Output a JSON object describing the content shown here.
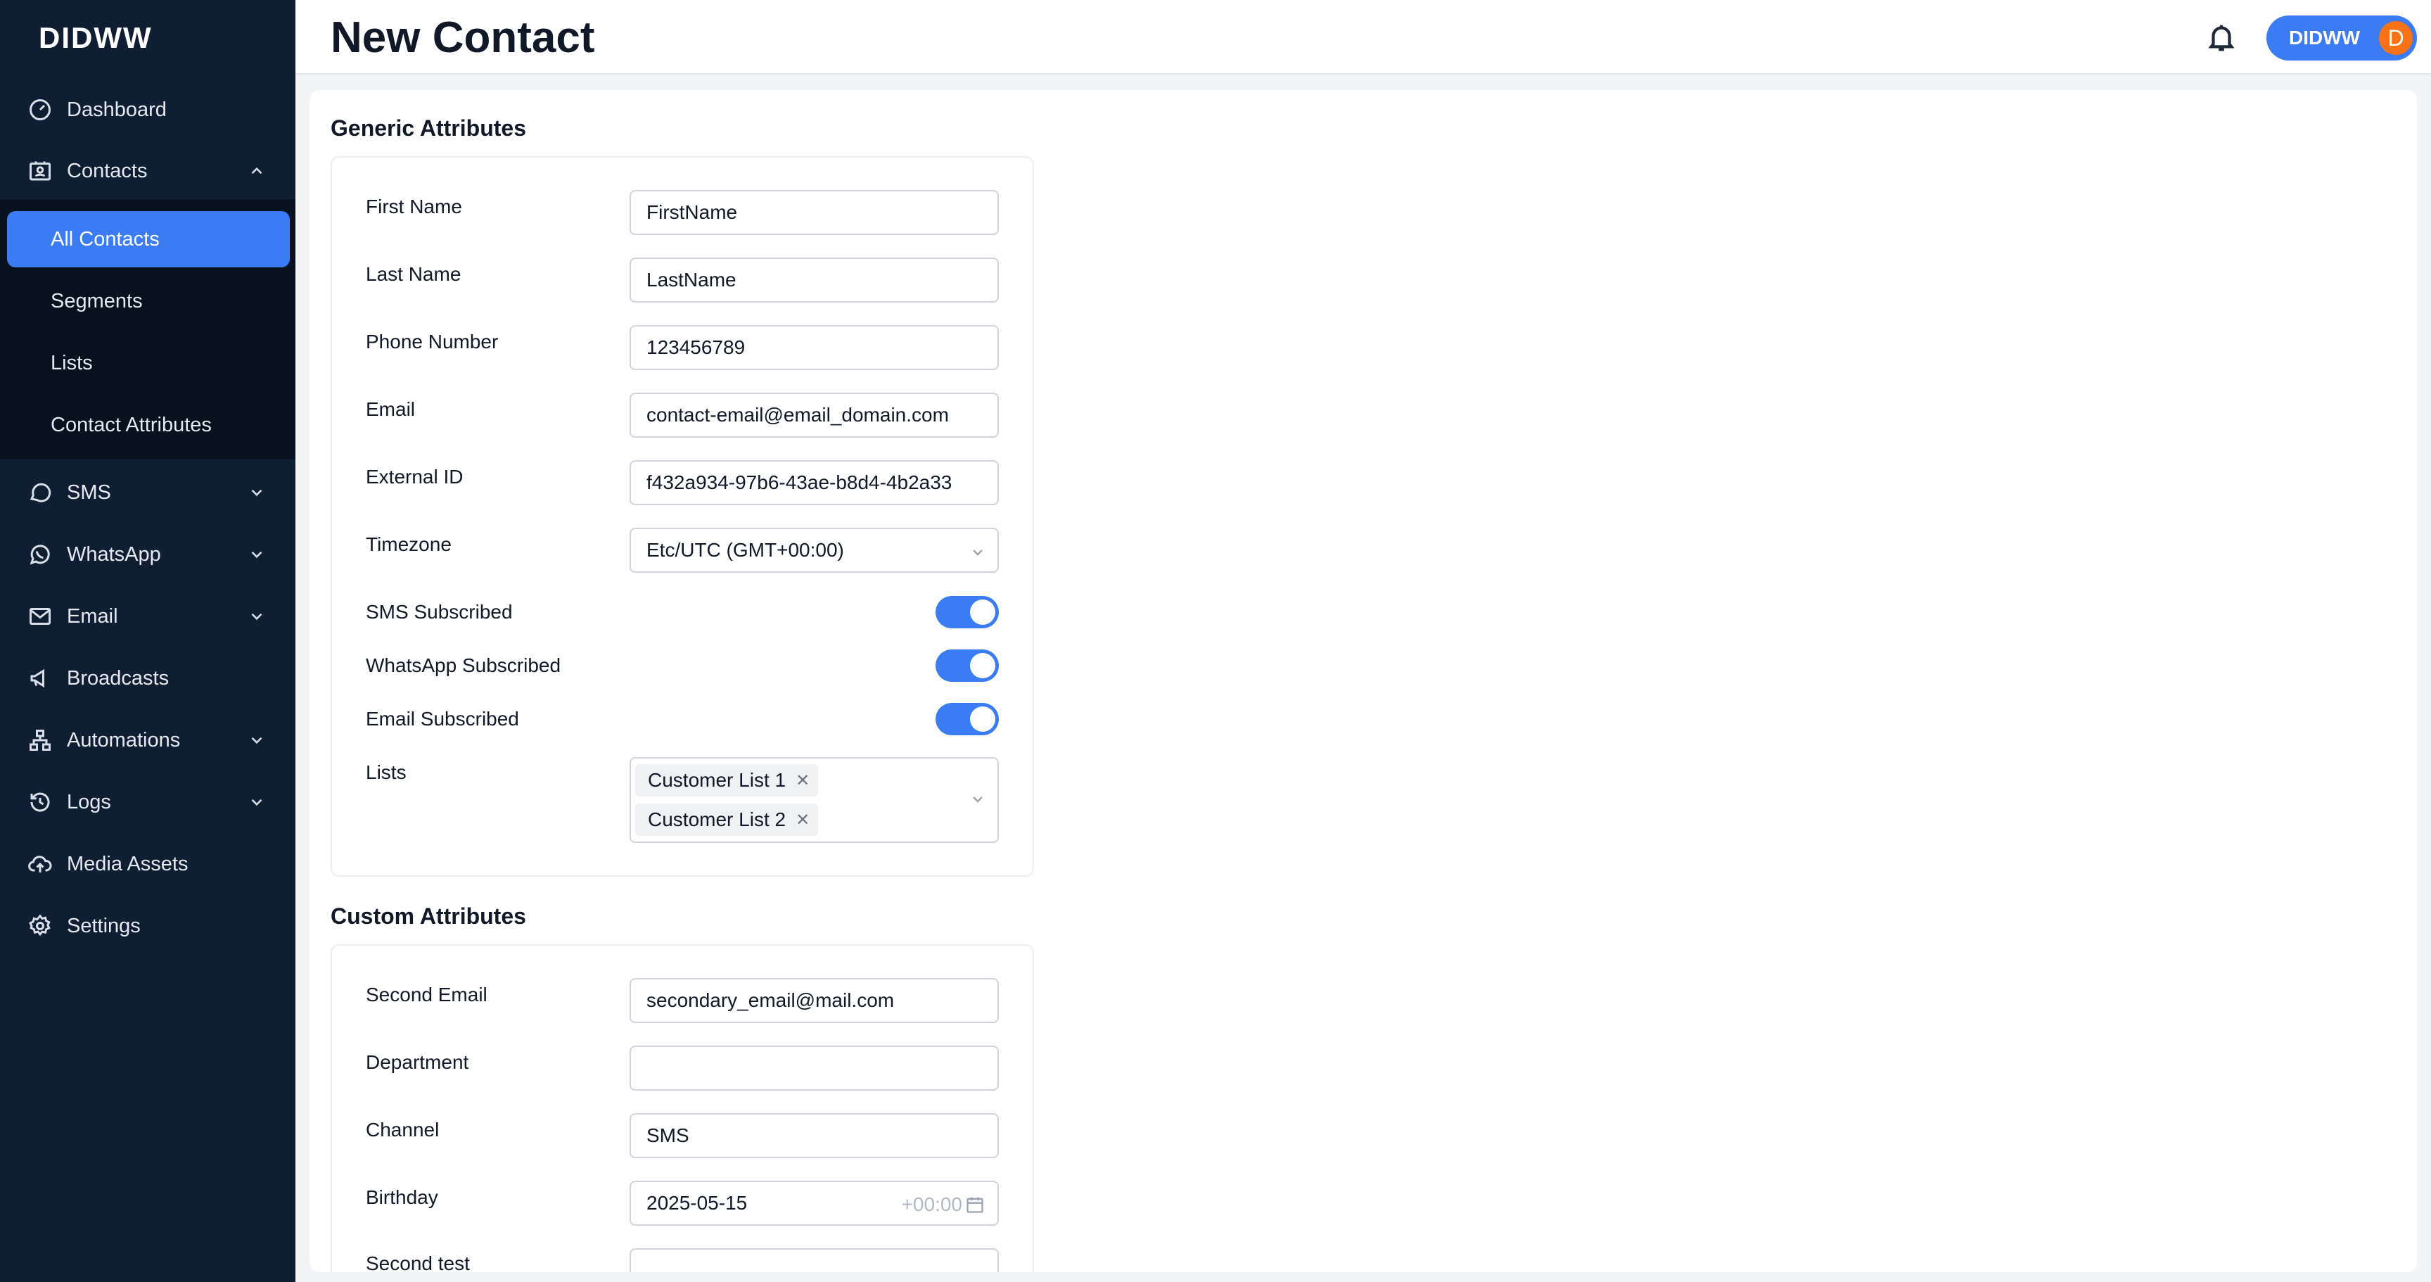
{
  "brand": "DIDWW",
  "header": {
    "title": "New Contact",
    "user_label": "DIDWW",
    "avatar_initial": "D"
  },
  "sidebar": {
    "items": [
      {
        "label": "Dashboard"
      },
      {
        "label": "Contacts"
      },
      {
        "label": "SMS"
      },
      {
        "label": "WhatsApp"
      },
      {
        "label": "Email"
      },
      {
        "label": "Broadcasts"
      },
      {
        "label": "Automations"
      },
      {
        "label": "Logs"
      },
      {
        "label": "Media Assets"
      },
      {
        "label": "Settings"
      }
    ],
    "contacts_sub": [
      {
        "label": "All Contacts"
      },
      {
        "label": "Segments"
      },
      {
        "label": "Lists"
      },
      {
        "label": "Contact Attributes"
      }
    ]
  },
  "generic": {
    "title": "Generic Attributes",
    "first_name": {
      "label": "First Name",
      "value": "FirstName"
    },
    "last_name": {
      "label": "Last Name",
      "value": "LastName"
    },
    "phone": {
      "label": "Phone Number",
      "value": "123456789"
    },
    "email": {
      "label": "Email",
      "value": "contact-email@email_domain.com"
    },
    "external_id": {
      "label": "External ID",
      "value": "f432a934-97b6-43ae-b8d4-4b2a33"
    },
    "timezone": {
      "label": "Timezone",
      "value": "Etc/UTC (GMT+00:00)"
    },
    "sms_sub": {
      "label": "SMS Subscribed",
      "on": true
    },
    "wa_sub": {
      "label": "WhatsApp Subscribed",
      "on": true
    },
    "email_sub": {
      "label": "Email Subscribed",
      "on": true
    },
    "lists": {
      "label": "Lists",
      "tags": [
        "Customer List 1",
        "Customer List 2"
      ]
    }
  },
  "custom": {
    "title": "Custom Attributes",
    "second_email": {
      "label": "Second Email",
      "value": "secondary_email@mail.com"
    },
    "department": {
      "label": "Department",
      "value": ""
    },
    "channel": {
      "label": "Channel",
      "value": "SMS"
    },
    "birthday": {
      "label": "Birthday",
      "value": "2025-05-15",
      "tz": "+00:00"
    },
    "second_test": {
      "label": "Second test",
      "value": ""
    }
  }
}
